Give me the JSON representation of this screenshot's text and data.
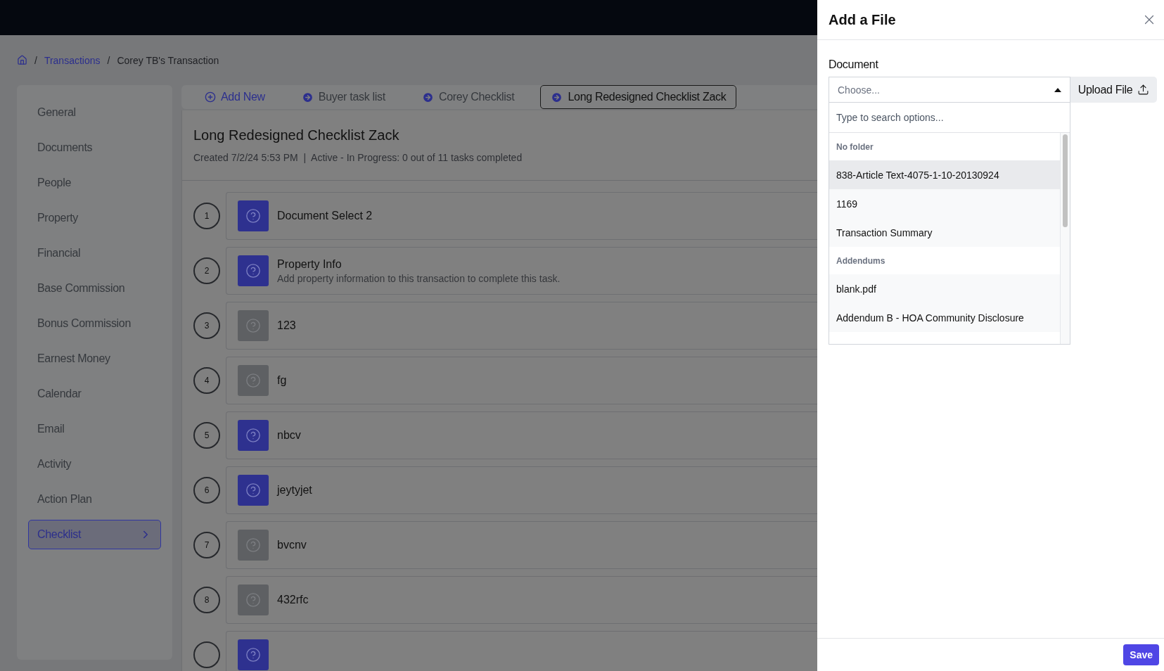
{
  "breadcrumb": [
    {
      "label": "Transactions",
      "link": true,
      "separator": "/"
    },
    {
      "label": "Corey TB's Transaction",
      "link": false,
      "separator": "/"
    }
  ],
  "sidebar": {
    "items": [
      {
        "label": "General",
        "selected": false
      },
      {
        "label": "Documents",
        "selected": false
      },
      {
        "label": "People",
        "selected": false
      },
      {
        "label": "Property",
        "selected": false
      },
      {
        "label": "Financial",
        "selected": false
      },
      {
        "label": "Base Commission",
        "selected": false
      },
      {
        "label": "Bonus Commission",
        "selected": false
      },
      {
        "label": "Earnest Money",
        "selected": false
      },
      {
        "label": "Calendar",
        "selected": false
      },
      {
        "label": "Email",
        "selected": false
      },
      {
        "label": "Activity",
        "selected": false
      },
      {
        "label": "Action Plan",
        "selected": false
      },
      {
        "label": "Checklist",
        "selected": true
      }
    ]
  },
  "tabs": [
    {
      "label": "Add New",
      "kind": "add",
      "selected": false
    },
    {
      "label": "Buyer task list",
      "kind": "checklist",
      "selected": false
    },
    {
      "label": "Corey Checklist",
      "kind": "checklist",
      "selected": false
    },
    {
      "label": "Long Redesigned Checklist Zack",
      "kind": "checklist",
      "selected": true
    }
  ],
  "checklist": {
    "title": "Long Redesigned Checklist Zack",
    "meta": "Created 7/2/24 5:53 PM  |  Active - In Progress: 0 out of 11 tasks completed",
    "tasks": [
      {
        "number": "1",
        "title": "Document Select 2",
        "disabled": false
      },
      {
        "number": "2",
        "title": "Property Info",
        "description": "Add property information to this transaction to complete this task.",
        "disabled": false
      },
      {
        "number": "3",
        "title": "123",
        "disabled": true
      },
      {
        "number": "4",
        "title": "fg",
        "disabled": true
      },
      {
        "number": "5",
        "title": "nbcv",
        "disabled": false
      },
      {
        "number": "6",
        "title": "jeytyjet",
        "disabled": false
      },
      {
        "number": "7",
        "title": "bvcnv",
        "disabled": true
      },
      {
        "number": "8",
        "title": "432rfc",
        "disabled": true
      },
      {
        "disabled": false
      }
    ]
  },
  "drawer": {
    "title": "Add a File",
    "field_label": "Document",
    "select": {
      "placeholder": "Choose...",
      "expanded": true
    },
    "upload_button": "Upload File",
    "search": {
      "placeholder": "Type to search options..."
    },
    "groups": [
      {
        "label": "No folder",
        "options": [
          {
            "label": "838-Article Text-4075-1-10-20130924",
            "highlighted": true
          },
          {
            "label": "1169",
            "highlighted": false
          },
          {
            "label": "Transaction Summary",
            "highlighted": false
          }
        ]
      },
      {
        "label": "Addendums",
        "options": [
          {
            "label": "blank.pdf",
            "highlighted": false
          },
          {
            "label": "Addendum B - HOA Community Disclosure",
            "highlighted": false
          }
        ]
      }
    ],
    "save_button": "Save"
  }
}
